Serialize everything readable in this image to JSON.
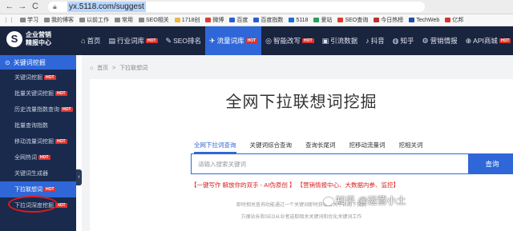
{
  "browser": {
    "back": "←",
    "forward": "→",
    "reload": "C",
    "url": "yx.5118.com/suggest",
    "bookmarks": [
      "学习",
      "我的博客",
      "以前工作",
      "常用",
      "SEO相关",
      "1718创",
      "微博",
      "百度",
      "百度指数",
      "5118",
      "爱站",
      "SEO查询",
      "今日热榜",
      "TechWeb",
      "亿邦"
    ],
    "bookmark_colors": [
      "#888888",
      "#888888",
      "#888888",
      "#888888",
      "#888888",
      "#f3b54a",
      "#e03a2e",
      "#2a5cd6",
      "#2a5cd6",
      "#1c6ed6",
      "#26a35c",
      "#e03a2e",
      "#c0302a",
      "#1f4fa8",
      "#d8332a"
    ]
  },
  "header": {
    "logo_mark": "S",
    "logo_line1": "企业营销",
    "logo_line2": "精报中心",
    "nav": [
      {
        "icon": "⌂",
        "label": "首页",
        "hot": ""
      },
      {
        "icon": "▤",
        "label": "行业词库",
        "hot": "HOT"
      },
      {
        "icon": "✎",
        "label": "SEO排名",
        "hot": ""
      },
      {
        "icon": "✈",
        "label": "流量词库",
        "hot": "HOT"
      },
      {
        "icon": "◎",
        "label": "智能改写",
        "hot": "HOT"
      },
      {
        "icon": "▣",
        "label": "引流数据",
        "hot": ""
      },
      {
        "icon": "♪",
        "label": "抖音",
        "hot": ""
      },
      {
        "icon": "◍",
        "label": "知乎",
        "hot": ""
      },
      {
        "icon": "⚙",
        "label": "营销情报",
        "hot": ""
      },
      {
        "icon": "⊕",
        "label": "API商城",
        "hot": "HOT"
      }
    ],
    "active_index": 3
  },
  "sidebar": {
    "section": "关键词挖掘",
    "items": [
      {
        "label": "关键词挖掘",
        "hot": "HOT"
      },
      {
        "label": "批量关键词挖掘",
        "hot": "HOT"
      },
      {
        "label": "历史流量指数查询",
        "hot": "HOT"
      },
      {
        "label": "批量查询指数",
        "hot": ""
      },
      {
        "label": "移动流量词挖掘",
        "hot": "HOT"
      },
      {
        "label": "全网热词",
        "hot": "HOT"
      },
      {
        "label": "关键词生成器",
        "hot": ""
      },
      {
        "label": "下拉联想词",
        "hot": "HOT"
      },
      {
        "label": "下拉词深度挖掘",
        "hot": "HOT"
      }
    ],
    "active_index": 7,
    "collapse": "‹"
  },
  "content": {
    "breadcrumb_home": "首页",
    "breadcrumb_sep": ">",
    "breadcrumb_current": "下拉联想词",
    "title": "全网下拉联想词挖掘",
    "tabs": [
      "全网下拉词查询",
      "关键词综合查询",
      "查询长尾词",
      "挖移动流量词",
      "挖相关词"
    ],
    "active_tab": 0,
    "search_placeholder": "请输入搜索关键词",
    "search_button": "查询",
    "promo": "【一键写作 解放你的双手 - AI伪原创 】  【营销情报中心、大数据内参、监控】",
    "desc_line1": "即时相关查询功能通过一个关键词即时获取各大平台的下拉词",
    "desc_line2": "方便站长和SEO从业者选取相关关键词和优化关键词工作",
    "watermark": "知乎 @运营小土"
  }
}
